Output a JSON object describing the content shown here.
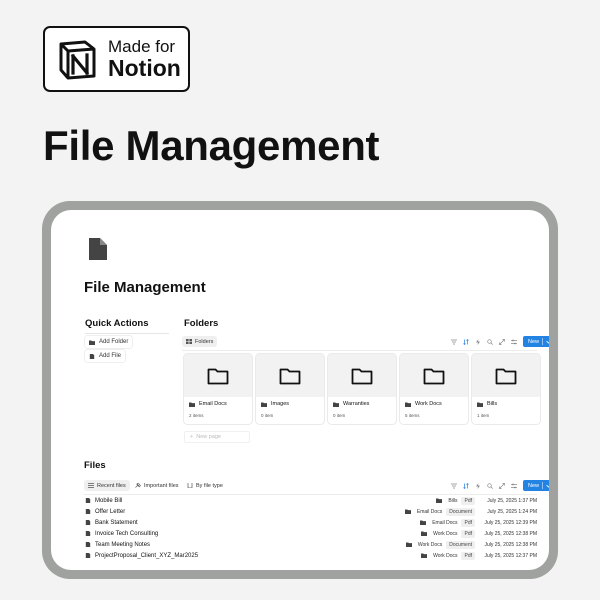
{
  "badge": {
    "line1": "Made for",
    "line2": "Notion"
  },
  "hero_title": "File Management",
  "page": {
    "title": "File Management",
    "quick_actions": {
      "title": "Quick Actions",
      "buttons": [
        "Add Folder",
        "Add File"
      ]
    },
    "folders": {
      "title": "Folders",
      "view_tab": "Folders",
      "new_label": "New",
      "cards": [
        {
          "name": "Email Docs",
          "count": "2 items"
        },
        {
          "name": "Images",
          "count": "0 item"
        },
        {
          "name": "Warranties",
          "count": "0 item"
        },
        {
          "name": "Work Docs",
          "count": "5 items"
        },
        {
          "name": "Bills",
          "count": "1 item"
        }
      ],
      "new_page": "New page"
    },
    "files": {
      "title": "Files",
      "tabs": [
        "Recent files",
        "Important files",
        "By file type"
      ],
      "new_label": "New",
      "rows": [
        {
          "name": "Mobile Bill",
          "folder": "Bills",
          "type": "Pdf",
          "date": "July 25, 2025 1:37 PM"
        },
        {
          "name": "Offer Letter",
          "folder": "Email Docs",
          "type": "Document",
          "date": "July 25, 2025 1:24 PM"
        },
        {
          "name": "Bank Statement",
          "folder": "Email Docs",
          "type": "Pdf",
          "date": "July 25, 2025 12:39 PM"
        },
        {
          "name": "Invoice Tech Consulting",
          "folder": "Work Docs",
          "type": "Pdf",
          "date": "July 25, 2025 12:38 PM"
        },
        {
          "name": "Team Meeting Notes",
          "folder": "Work Docs",
          "type": "Document",
          "date": "July 25, 2025 12:38 PM"
        },
        {
          "name": "ProjectProposal_Client_XYZ_Mar2025",
          "folder": "Work Docs",
          "type": "Pdf",
          "date": "July 25, 2025 12:37 PM"
        }
      ]
    }
  },
  "colors": {
    "accent": "#2383e2",
    "frame": "#9fa29f",
    "background": "#f3f3f3"
  },
  "icons": {
    "logo": "notion-logo",
    "page": "document-icon",
    "folder": "folder-icon",
    "file": "file-icon"
  }
}
